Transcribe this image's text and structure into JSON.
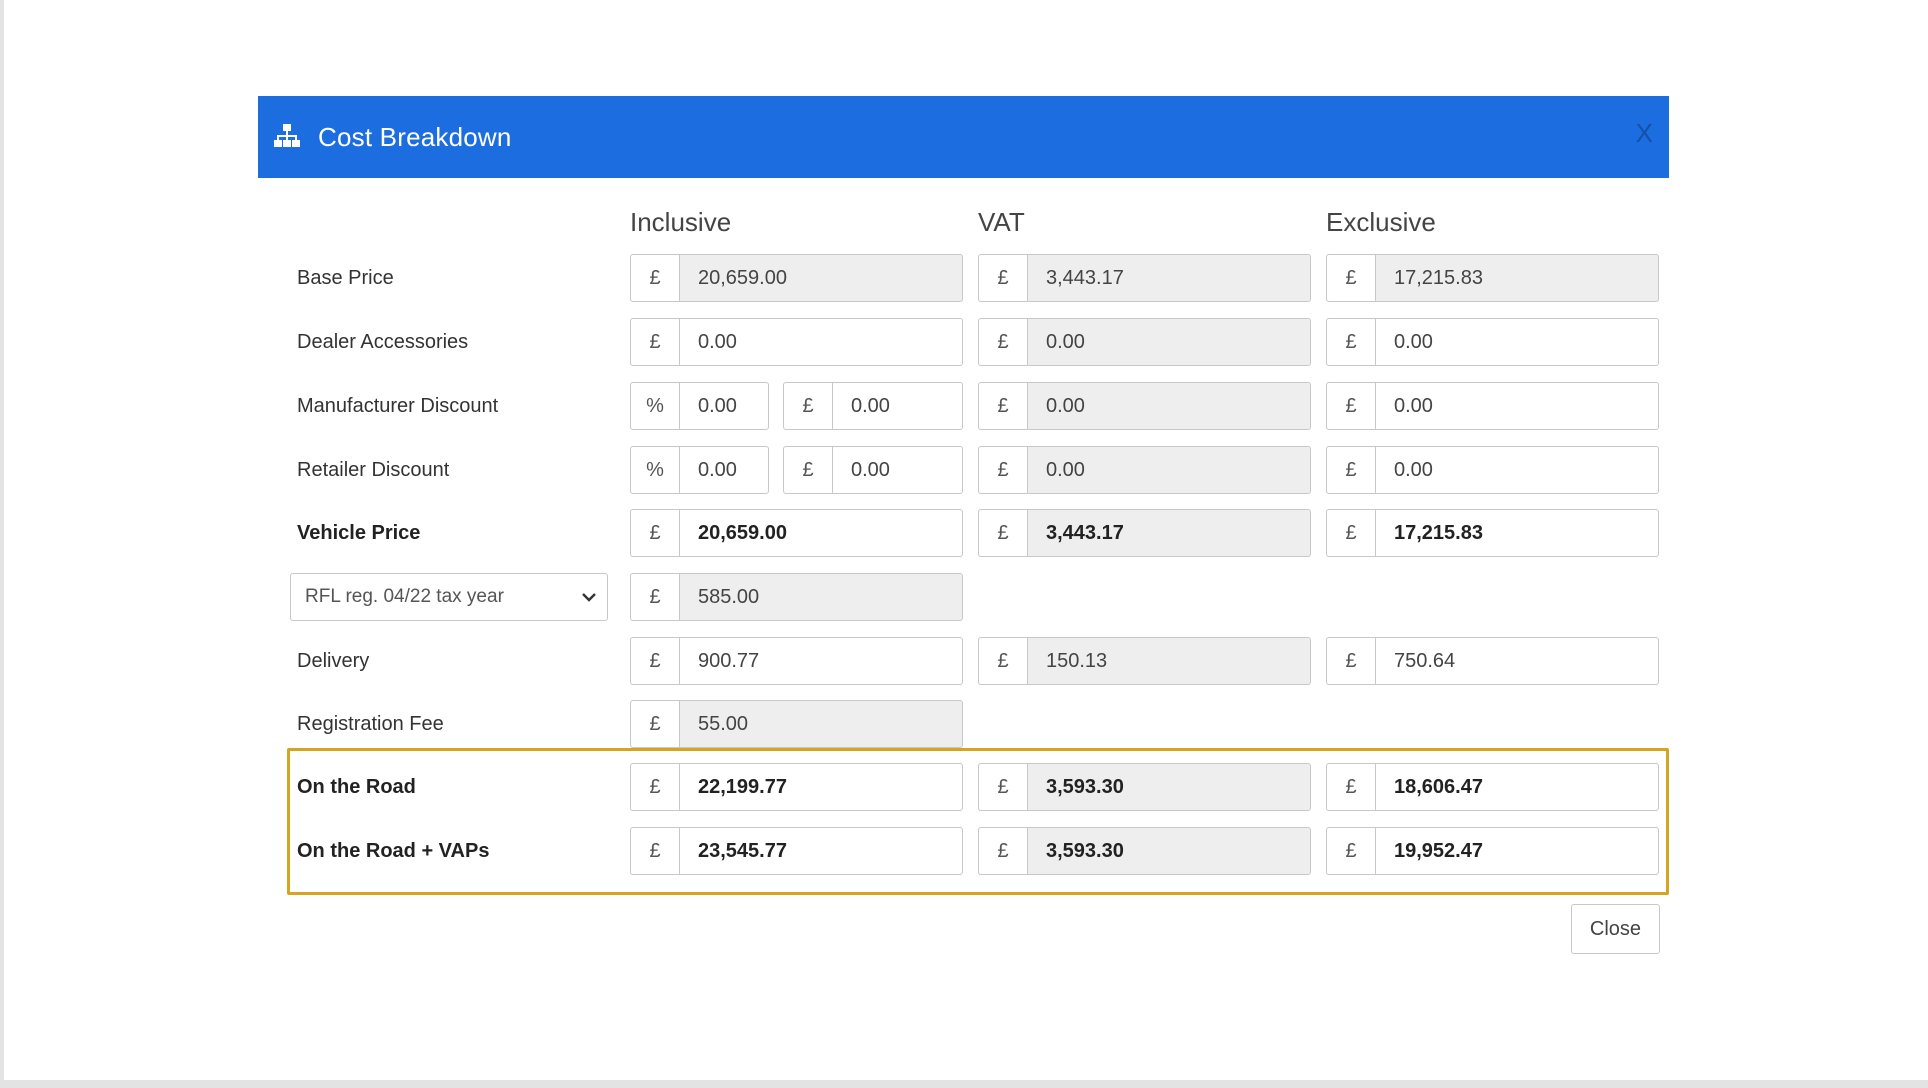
{
  "dialog": {
    "title": "Cost Breakdown",
    "icon": "sitemap-icon",
    "close_glyph": "X",
    "close_button_label": "Close"
  },
  "columns": {
    "inclusive": "Inclusive",
    "vat": "VAT",
    "exclusive": "Exclusive"
  },
  "currency_symbol": "£",
  "percent_symbol": "%",
  "rows": {
    "base_price": {
      "label": "Base Price",
      "inclusive": "20,659.00",
      "vat": "3,443.17",
      "exclusive": "17,215.83"
    },
    "dealer_accessories": {
      "label": "Dealer Accessories",
      "inclusive": "0.00",
      "vat": "0.00",
      "exclusive": "0.00"
    },
    "manufacturer_discount": {
      "label": "Manufacturer Discount",
      "percent": "0.00",
      "inclusive": "0.00",
      "vat": "0.00",
      "exclusive": "0.00"
    },
    "retailer_discount": {
      "label": "Retailer Discount",
      "percent": "0.00",
      "inclusive": "0.00",
      "vat": "0.00",
      "exclusive": "0.00"
    },
    "vehicle_price": {
      "label": "Vehicle Price",
      "inclusive": "20,659.00",
      "vat": "3,443.17",
      "exclusive": "17,215.83"
    },
    "rfl": {
      "select_value": "RFL reg. 04/22 tax year",
      "inclusive": "585.00"
    },
    "delivery": {
      "label": "Delivery",
      "inclusive": "900.77",
      "vat": "150.13",
      "exclusive": "750.64"
    },
    "registration_fee": {
      "label": "Registration Fee",
      "inclusive": "55.00"
    },
    "on_the_road": {
      "label": "On the Road",
      "inclusive": "22,199.77",
      "vat": "3,593.30",
      "exclusive": "18,606.47"
    },
    "on_the_road_vaps": {
      "label": "On the Road + VAPs",
      "inclusive": "23,545.77",
      "vat": "3,593.30",
      "exclusive": "19,952.47"
    }
  },
  "colors": {
    "header_bg": "#1b6de0",
    "highlight_border": "#d4a520",
    "readonly_bg": "#eeeeee"
  }
}
